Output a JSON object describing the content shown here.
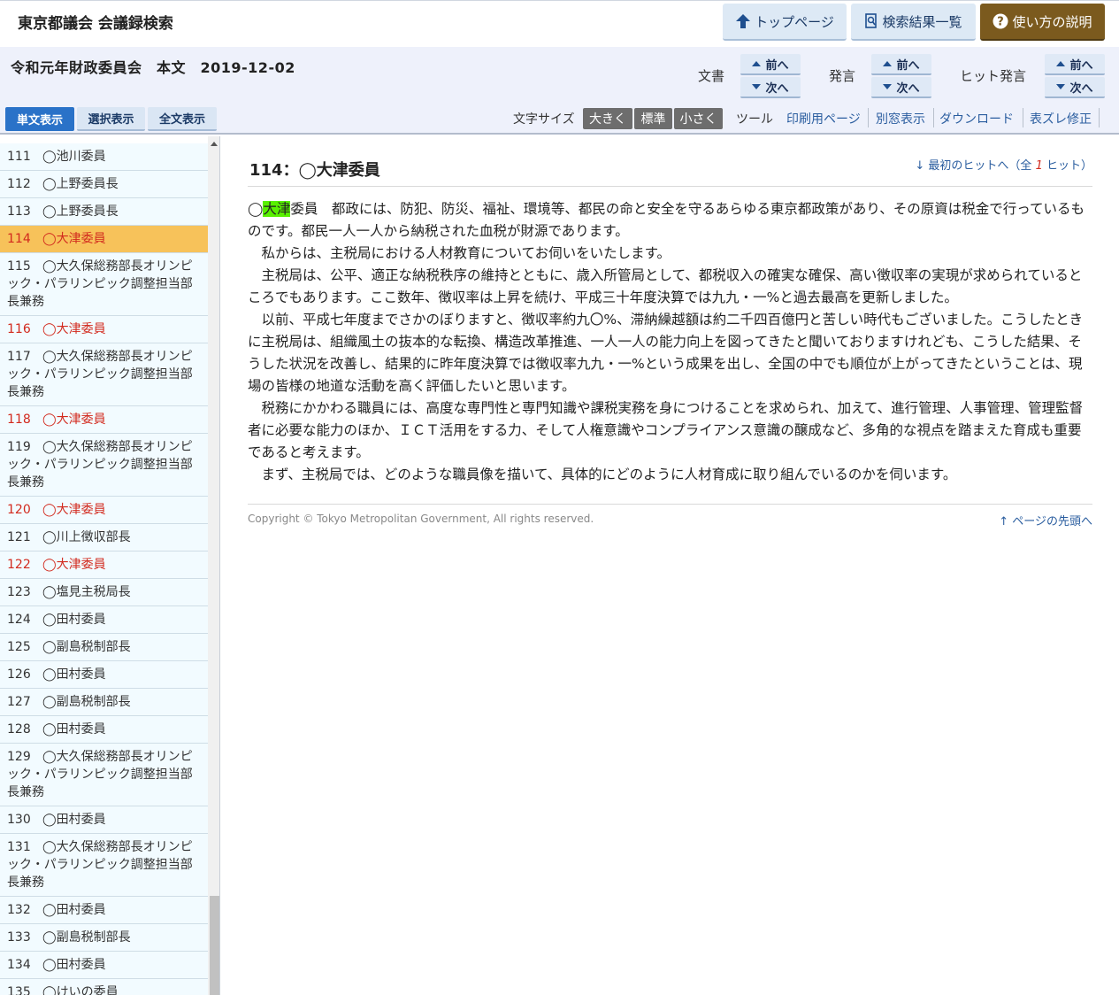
{
  "header": {
    "site_title": "東京都議会 会議録検索",
    "buttons": {
      "top_page": "トップページ",
      "search_results": "検索結果一覧",
      "how_to_use": "使い方の説明"
    }
  },
  "doc": {
    "title": "令和元年財政委員会　本文　2019-12-02",
    "nav": {
      "document_label": "文書",
      "speech_label": "発言",
      "hit_label": "ヒット発言",
      "prev": "前へ",
      "next": "次へ"
    },
    "views": {
      "single": "単文表示",
      "selected": "選択表示",
      "full": "全文表示"
    },
    "text_size": {
      "label": "文字サイズ",
      "large": "大きく",
      "standard": "標準",
      "small": "小さく"
    },
    "tools": {
      "label": "ツール",
      "print": "印刷用ページ",
      "window": "別窓表示",
      "download": "ダウンロード",
      "fix": "表ズレ修正"
    }
  },
  "sidebar": {
    "items": [
      {
        "num": "111",
        "label": "◯池川委員",
        "state": "normal"
      },
      {
        "num": "112",
        "label": "◯上野委員長",
        "state": "normal"
      },
      {
        "num": "113",
        "label": "◯上野委員長",
        "state": "normal"
      },
      {
        "num": "114",
        "label": "◯大津委員",
        "state": "active"
      },
      {
        "num": "115",
        "label": "◯大久保総務部長オリンピック・パラリンピック調整担当部長兼務",
        "state": "normal"
      },
      {
        "num": "116",
        "label": "◯大津委員",
        "state": "hit"
      },
      {
        "num": "117",
        "label": "◯大久保総務部長オリンピック・パラリンピック調整担当部長兼務",
        "state": "normal"
      },
      {
        "num": "118",
        "label": "◯大津委員",
        "state": "hit"
      },
      {
        "num": "119",
        "label": "◯大久保総務部長オリンピック・パラリンピック調整担当部長兼務",
        "state": "normal"
      },
      {
        "num": "120",
        "label": "◯大津委員",
        "state": "hit"
      },
      {
        "num": "121",
        "label": "◯川上徴収部長",
        "state": "normal"
      },
      {
        "num": "122",
        "label": "◯大津委員",
        "state": "hit"
      },
      {
        "num": "123",
        "label": "◯塩見主税局長",
        "state": "normal"
      },
      {
        "num": "124",
        "label": "◯田村委員",
        "state": "normal"
      },
      {
        "num": "125",
        "label": "◯副島税制部長",
        "state": "normal"
      },
      {
        "num": "126",
        "label": "◯田村委員",
        "state": "normal"
      },
      {
        "num": "127",
        "label": "◯副島税制部長",
        "state": "normal"
      },
      {
        "num": "128",
        "label": "◯田村委員",
        "state": "normal"
      },
      {
        "num": "129",
        "label": "◯大久保総務部長オリンピック・パラリンピック調整担当部長兼務",
        "state": "normal"
      },
      {
        "num": "130",
        "label": "◯田村委員",
        "state": "normal"
      },
      {
        "num": "131",
        "label": "◯大久保総務部長オリンピック・パラリンピック調整担当部長兼務",
        "state": "normal"
      },
      {
        "num": "132",
        "label": "◯田村委員",
        "state": "normal"
      },
      {
        "num": "133",
        "label": "◯副島税制部長",
        "state": "normal"
      },
      {
        "num": "134",
        "label": "◯田村委員",
        "state": "normal"
      },
      {
        "num": "135",
        "label": "◯けいの委員",
        "state": "normal"
      }
    ]
  },
  "main": {
    "speech_title": "114：◯大津委員",
    "first_hit": {
      "prefix": "↓ 最初のヒットへ（全 ",
      "count": "1",
      "suffix": " ヒット）"
    },
    "speech": {
      "lead_mark": "◯",
      "highlight": "大津",
      "first_rest": "委員　都政には、防犯、防災、福祉、環境等、都民の命と安全を守るあらゆる東京都政策があり、その原資は税金で行っているものです。都民一人一人から納税された血税が財源であります。",
      "paragraphs": [
        "　私からは、主税局における人材教育についてお伺いをいたします。",
        "　主税局は、公平、適正な納税秩序の維持とともに、歳入所管局として、都税収入の確実な確保、高い徴収率の実現が求められているところでもあります。ここ数年、徴収率は上昇を続け、平成三十年度決算では九九・一%と過去最高を更新しました。",
        "　以前、平成七年度までさかのぼりますと、徴収率約九〇%、滞納繰越額は約二千四百億円と苦しい時代もございました。こうしたときに主税局は、組織風土の抜本的な転換、構造改革推進、一人一人の能力向上を図ってきたと聞いておりますけれども、こうした結果、そうした状況を改善し、結果的に昨年度決算では徴収率九九・一%という成果を出し、全国の中でも順位が上がってきたということは、現場の皆様の地道な活動を高く評価したいと思います。",
        "　税務にかかわる職員には、高度な専門性と専門知識や課税実務を身につけることを求められ、加えて、進行管理、人事管理、管理監督者に必要な能力のほか、ＩＣＴ活用をする力、そして人権意識やコンプライアンス意識の醸成など、多角的な視点を踏まえた育成も重要であると考えます。",
        "　まず、主税局では、どのような職員像を描いて、具体的にどのように人材育成に取り組んでいるのかを伺います。"
      ]
    },
    "copyright": "Copyright © Tokyo Metropolitan Government, All rights reserved.",
    "to_top": "↑ ページの先頭へ"
  },
  "colors": {
    "active_row": "#f7c25a",
    "hit_text": "#d22a1e",
    "highlight": "#58f000",
    "help_button": "#7b5a1e",
    "view_active": "#2a72c8"
  }
}
